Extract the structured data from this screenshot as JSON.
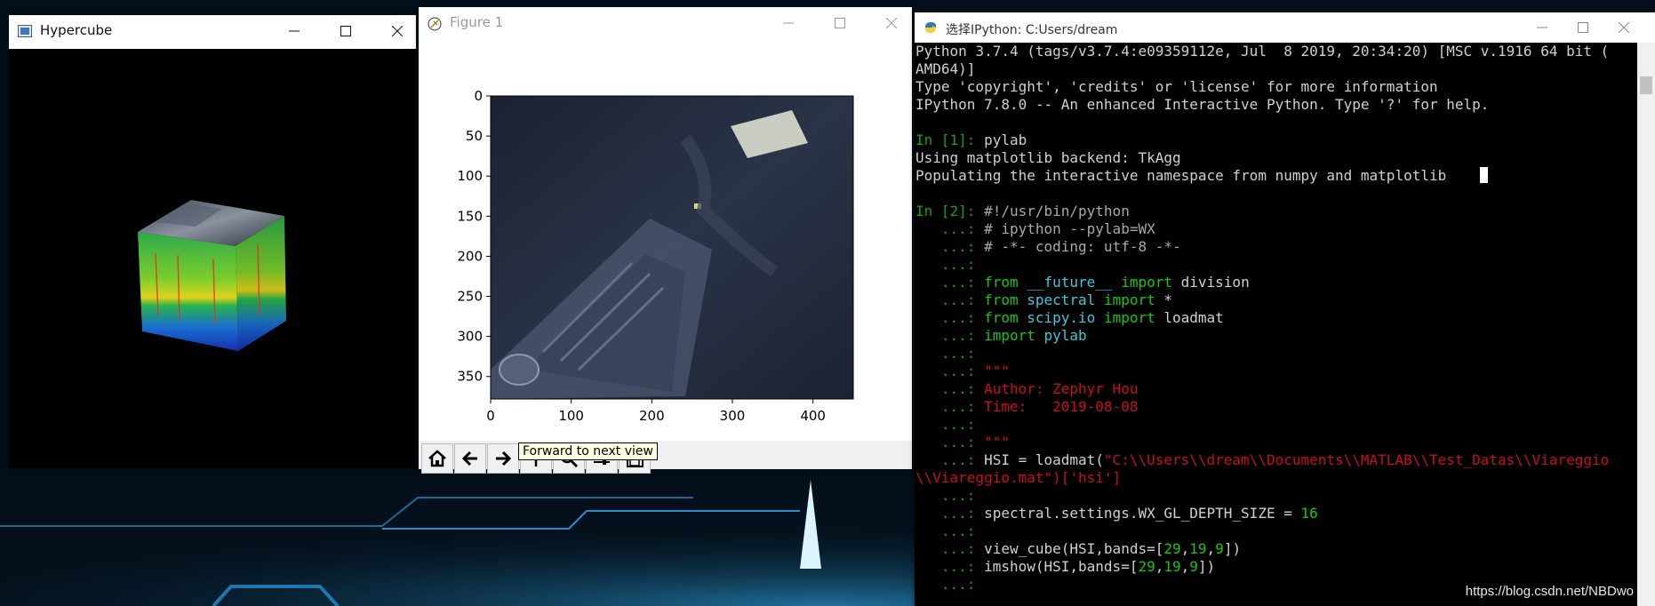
{
  "hypercube": {
    "title": "Hypercube"
  },
  "figure": {
    "title": "Figure 1",
    "y_ticks": [
      "0",
      "50",
      "100",
      "150",
      "200",
      "250",
      "300",
      "350"
    ],
    "x_ticks": [
      "0",
      "100",
      "200",
      "300",
      "400"
    ],
    "tooltip": "Forward to next view",
    "tools": [
      "home-icon",
      "back-arrow-icon",
      "forward-arrow-icon",
      "pan-icon",
      "zoom-icon",
      "configure-icon",
      "save-icon"
    ]
  },
  "console": {
    "title": "选择IPython: C:Users/dream",
    "lines": [
      "Python 3.7.4 (tags/v3.7.4:e09359112e, Jul  8 2019, 20:34:20) [MSC v.1916 64 bit (",
      "AMD64)]",
      "Type 'copyright', 'credits' or 'license' for more information",
      "IPython 7.8.0 -- An enhanced Interactive Python. Type '?' for help.",
      "",
      "In [1]: pylab",
      "Using matplotlib backend: TkAgg",
      "Populating the interactive namespace from numpy and matplotlib",
      "",
      "In [2]: #!/usr/bin/python",
      "   ...: # ipython --pylab=WX",
      "   ...: # -*- coding: utf-8 -*-",
      "   ...:",
      "   ...: from __future__ import division",
      "   ...: from spectral import *",
      "   ...: from scipy.io import loadmat",
      "   ...: import pylab",
      "   ...:",
      "   ...: \"\"\"",
      "   ...: Author: Zephyr Hou",
      "   ...: Time:   2019-08-08",
      "   ...:",
      "   ...: \"\"\"",
      "   ...: HSI = loadmat(\"C:\\\\Users\\\\dream\\\\Documents\\\\MATLAB\\\\Test_Datas\\\\Viareggio",
      "\\\\Viareggio.mat\")['hsi']",
      "   ...:",
      "   ...: spectral.settings.WX_GL_DEPTH_SIZE = 16",
      "   ...:",
      "   ...: view_cube(HSI,bands=[29,19,9])",
      "   ...: imshow(HSI,bands=[29,19,9])",
      "   ...:"
    ],
    "watermark": "https://blog.csdn.net/NBDwo"
  },
  "colors": {
    "desktop": "#03101c",
    "terminal_bg": "#000000",
    "prompt_green": "#13a10e",
    "string_red": "#c50f1f",
    "module_cyan": "#3ec7d8"
  }
}
